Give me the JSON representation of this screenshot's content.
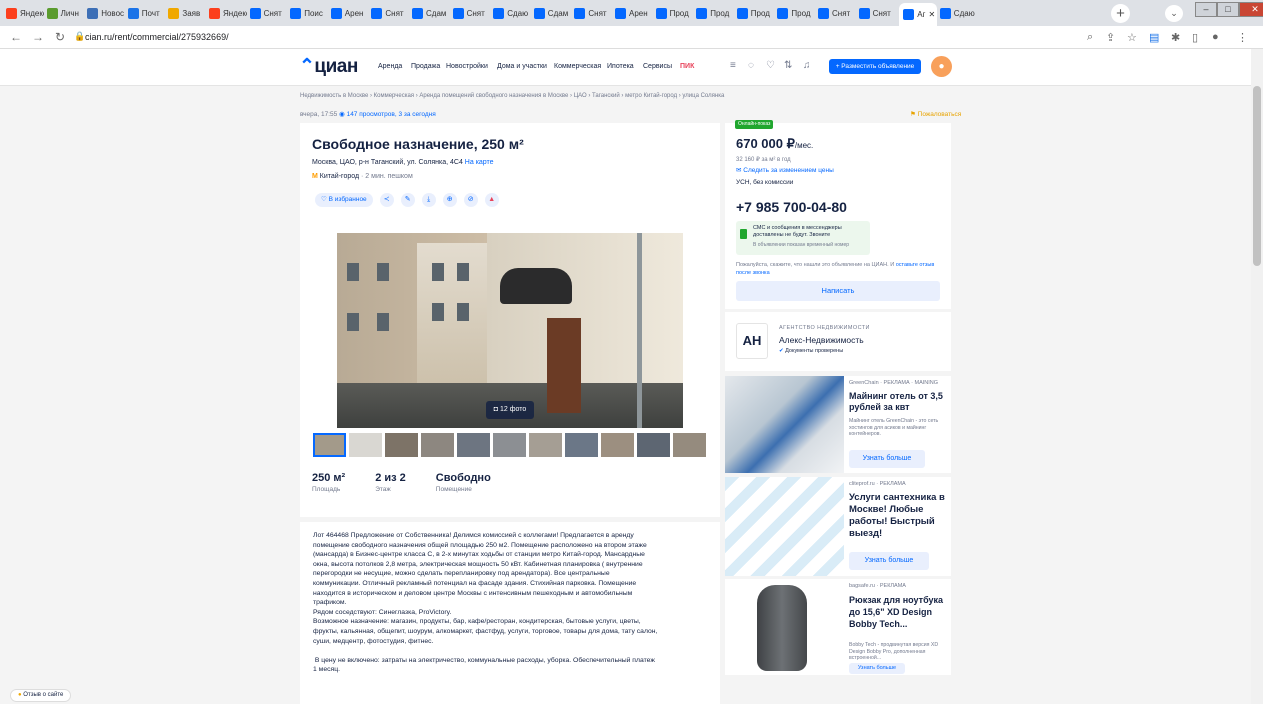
{
  "browser": {
    "tabs": [
      {
        "label": "Яндекс",
        "icon": "yandex-icon",
        "color": "#fc3f1d"
      },
      {
        "label": "Личн",
        "icon": "person-icon",
        "color": "#5a9b2e"
      },
      {
        "label": "Новос",
        "icon": "news-icon",
        "color": "#3d6fb6"
      },
      {
        "label": "Почт",
        "icon": "mail-icon",
        "color": "#1a73e8"
      },
      {
        "label": "Заяв",
        "icon": "bee-icon",
        "color": "#f0a800"
      },
      {
        "label": "Яндекс",
        "icon": "yandex-icon",
        "color": "#fc3f1d"
      },
      {
        "label": "Снят",
        "icon": "cian-icon",
        "color": "#0468ff"
      },
      {
        "label": "Поис",
        "icon": "cian-icon",
        "color": "#0468ff"
      },
      {
        "label": "Арен",
        "icon": "cian-icon",
        "color": "#0468ff"
      },
      {
        "label": "Снят",
        "icon": "cian-icon",
        "color": "#0468ff"
      },
      {
        "label": "Сдам",
        "icon": "cian-icon",
        "color": "#0468ff"
      },
      {
        "label": "Снят",
        "icon": "cian-icon",
        "color": "#0468ff"
      },
      {
        "label": "Сдаю",
        "icon": "cian-icon",
        "color": "#0468ff"
      },
      {
        "label": "Сдам",
        "icon": "cian-icon",
        "color": "#0468ff"
      },
      {
        "label": "Снят",
        "icon": "cian-icon",
        "color": "#0468ff"
      },
      {
        "label": "Арен",
        "icon": "cian-icon",
        "color": "#0468ff"
      },
      {
        "label": "Прод",
        "icon": "cian-icon",
        "color": "#0468ff"
      },
      {
        "label": "Прод",
        "icon": "cian-icon",
        "color": "#0468ff"
      },
      {
        "label": "Прод",
        "icon": "cian-icon",
        "color": "#0468ff"
      },
      {
        "label": "Прод",
        "icon": "cian-icon",
        "color": "#0468ff"
      },
      {
        "label": "Снят",
        "icon": "cian-icon",
        "color": "#0468ff"
      },
      {
        "label": "Снят",
        "icon": "cian-icon",
        "color": "#0468ff"
      },
      {
        "label": "Аг",
        "icon": "cian-icon",
        "color": "#0468ff",
        "active": true
      },
      {
        "label": "Сдаю",
        "icon": "cian-icon",
        "color": "#0468ff"
      }
    ],
    "url": "cian.ru/rent/commercial/275932669/"
  },
  "header": {
    "logo": "циан",
    "menu": [
      "Аренда",
      "Продажа",
      "Новостройки",
      "Дома и участки",
      "Коммерческая",
      "Ипотека",
      "Сервисы"
    ],
    "pik": "ПИК",
    "place_ad": "+ Разместить объявление"
  },
  "breadcrumbs": "Недвижимость в Москве  ›  Коммерческая  ›  Аренда помещений свободного назначения в Москве  ›  ЦАО  ›  Таганский  ›  метро Китай-город  ›  улица Солянка",
  "meta": {
    "date": "вчера, 17:55",
    "views": "147 просмотров, 3 за сегодня",
    "complain": "Пожаловаться"
  },
  "listing": {
    "title": "Свободное назначение, 250 м²",
    "address": "Москва, ЦАО, р-н Таганский, ул. Солянка, 4С4",
    "map_link": "На карте",
    "metro": "Китай-город",
    "walk": "· 2 мин. пешком",
    "favorite": "♡ В избранное",
    "photo_count": "12 фото",
    "stats": [
      {
        "value": "250 м²",
        "label": "Площадь"
      },
      {
        "value": "2 из 2",
        "label": "Этаж"
      },
      {
        "value": "Свободно",
        "label": "Помещение"
      }
    ],
    "description": "Лот 464468 Предложение от Собственника! Делимся комиссией с коллегами! Предлагается в аренду\nпомещение свободного назначения общей площадью 250 м2. Помещение расположено на втором этаже\n(мансарда) в Бизнес-центре класса С, в 2-х минутах ходьбы от станции метро Китай-город. Мансардные\nокна, высота потолков 2,8 метра, электрическая мощность 50 кВт. Кабинетная планировка ( внутренние\nперегородки не несущие, можно сделать перепланировку под арендатора). Все центральные\nкоммуникации. Отличный рекламный потенциал на фасаде здания. Стихийная парковка. Помещение\nнаходится в историческом и деловом центре Москвы с интенсивным пешеходным и автомобильным\nтрафиком.\nРядом соседствуют: Синеглазка, ProVictory.\nВозможное назначение: магазин, продукты, бар, кафе/ресторан, кондитерская, бытовые услуги, цветы,\nфрукты, кальянная, общепит, шоурум, алкомаркет, фастфуд, услуги, торговое, товары для дома, тату салон,\nсуши, медцентр, фотостудия, фитнес.\n\n В цену не включено: затраты на электричество, коммунальные расходы, уборка. Обеспечительный платеж\n1 месяц."
  },
  "offer": {
    "badge": "Онлайн-показ",
    "price": "670 000 ₽",
    "price_unit": "/мес.",
    "per_meter": "32 160 ₽ за м² в год",
    "track": "Следить за изменением цены",
    "tax": "УСН, без комиссии",
    "phone": "+7 985 700-04-80",
    "sms_title": "СМС и сообщения в мессенджеры доставлены не будут. Звоните",
    "sms_sub": "В объявлении показан временный номер",
    "feedback": "Пожалуйста, скажите, что нашли это объявление на ЦИАН. И",
    "feedback_link": "оставьте отзыв после звонка",
    "write": "Написать"
  },
  "agency": {
    "logo": "АН",
    "type": "АГЕНТСТВО НЕДВИЖИМОСТИ",
    "name": "Алекс-Недвижимость",
    "docs": "Документы проверены"
  },
  "ads": [
    {
      "source": "GreenChain · РЕКЛАМА · MAINING",
      "title": "Майнинг отель от 3,5 рублей за квт",
      "text": "Майнинг отель GreenChain - это сеть хостингов для асиков и майнинг контейнеров.",
      "button": "Узнать больше"
    },
    {
      "source": "cliteprof.ru · РЕКЛАМА",
      "title": "Услуги сантехника в Москве! Любые работы! Быстрый выезд!",
      "text": "",
      "button": "Узнать больше"
    },
    {
      "source": "bagsafe.ru · РЕКЛАМА",
      "title": "Рюкзак для ноутбука до 15,6\" XD Design Bobby Tech...",
      "text": "Bobby Tech - продвинутая версия XD Design Bobby Pro, дополненная встроенной...",
      "button": "Узнать больше"
    }
  ],
  "online_pill": "Отзыв о сайте"
}
